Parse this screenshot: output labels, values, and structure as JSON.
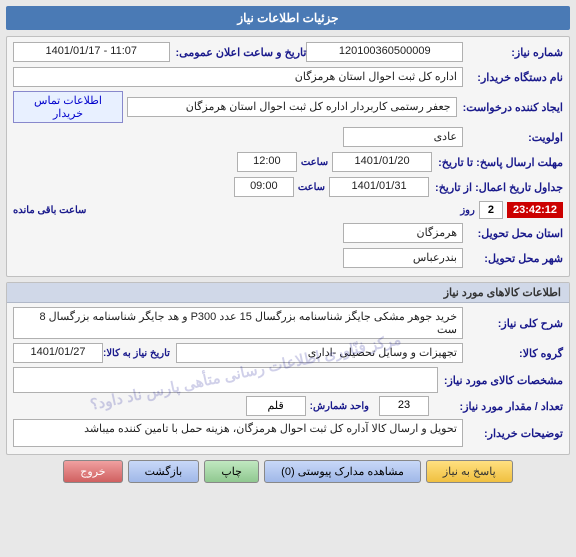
{
  "header": {
    "title": "جزئیات اطلاعات نیاز"
  },
  "section1": {
    "header": "",
    "rows": {
      "shomare_niyaz_label": "شماره نیاز:",
      "shomare_niyaz_value": "120100360500009",
      "tarikh_label": "تاریخ و ساعت اعلان عمومی:",
      "tarikh_value": "1401/01/17 - 11:07",
      "nam_dastgah_label": "نام دستگاه خریدار:",
      "nam_dastgah_value": "اداره کل ثبت احوال استان هرمزگان",
      "ijad_konande_label": "ایجاد کننده درخواست:",
      "ijad_konande_value": "جعفر رستمی کاربردار اداره کل ثبت احوال استان هرمزگان",
      "ittela_tamas_label": "اطلاعات تماس خریدار",
      "avoliyat_label": "اولویت:",
      "avoliyat_value": "عادی",
      "mohlat_ersal_label": "مهلت ارسال پاسخ: تا تاریخ:",
      "mohlat_date": "1401/01/20",
      "mohlat_saat_label": "ساعت",
      "mohlat_saat_value": "12:00",
      "jadval_label": "جداول تاریخ اعمال: از تاریخ:",
      "jadval_date": "1401/01/31",
      "jadval_saat_label": "ساعت",
      "jadval_saat_value": "09:00",
      "countdown_label": "ساعت باقی مانده",
      "countdown_time": "23:42:12",
      "countdown_day_label": "روز",
      "countdown_day_value": "2",
      "ostan_tahvil_label": "استان محل تحویل:",
      "ostan_tahvil_value": "هرمزگان",
      "shahr_tahvil_label": "شهر محل تحویل:",
      "shahr_tahvil_value": "بندرعباس"
    }
  },
  "section2": {
    "header": "اطلاعات کالاهای مورد نیاز",
    "sharkh_label": "شرح کلی نیاز:",
    "sharkh_value": "خرید جوهر مشکی جایگز شناسنامه بزرگسال 15 عدد P300 و هد جایگر شناسنامه بزرگسال 8 ست",
    "gorohe_kala_label": "گروه کالا:",
    "gorohe_kala_value": "تجهیزات و وسایل تحصیلی -اداری",
    "tarikh_niyaz_label": "تاریخ نیاز به کالا:",
    "tarikh_niyaz_value": "1401/01/27",
    "moshakhasat_label": "مشخصات کالای مورد نیاز:",
    "moshakhasat_value": "",
    "tedad_label": "تعداد / مقدار مورد نیاز:",
    "tedad_value": "23",
    "vahed_label": "واحد شمارش:",
    "vahed_value": "قلم",
    "tozi_label": "توضیحات خریدار:",
    "tozi_value": "تحویل و ارسال کالا آداره کل ثبت احوال هرمزگان، هزینه حمل با تامین کننده میباشد"
  },
  "buttons": {
    "pasokh_label": "پاسخ به نیاز",
    "moshahedeh_label": "مشاهده مدارک پیوستی (0)",
    "chap_label": "چاپ",
    "bazgasht_label": "بازگشت",
    "khoroj_label": "خروج"
  }
}
